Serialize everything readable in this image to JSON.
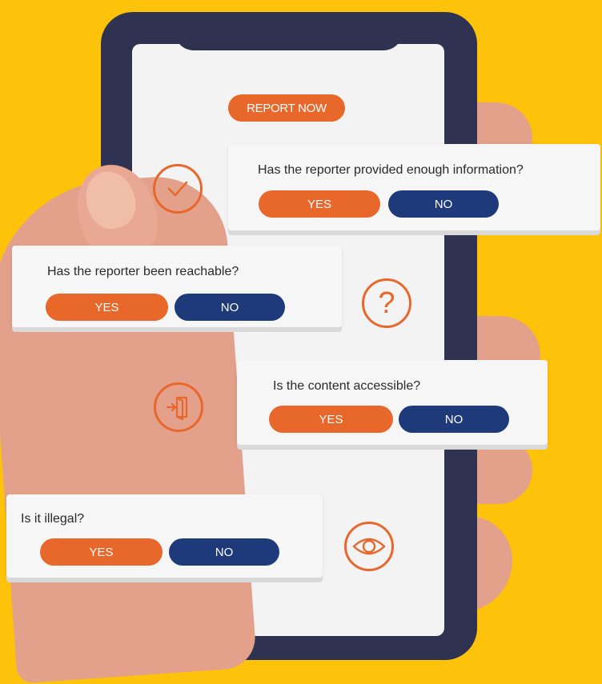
{
  "report_button": {
    "label": "REPORT NOW"
  },
  "cards": [
    {
      "question": "Has the reporter provided enough information?",
      "yes": "YES",
      "no": "NO"
    },
    {
      "question": "Has the reporter been reachable?",
      "yes": "YES",
      "no": "NO"
    },
    {
      "question": "Is the content accessible?",
      "yes": "YES",
      "no": "NO"
    },
    {
      "question": "Is it illegal?",
      "yes": "YES",
      "no": "NO"
    }
  ],
  "icons": {
    "question_mark": "?",
    "names": [
      "checkmark-icon",
      "question-icon",
      "door-exit-icon",
      "eye-icon"
    ]
  },
  "colors": {
    "background": "#fdc20a",
    "accent": "#e8672a",
    "navy": "#1e3a7b",
    "phone": "#2f3250"
  }
}
